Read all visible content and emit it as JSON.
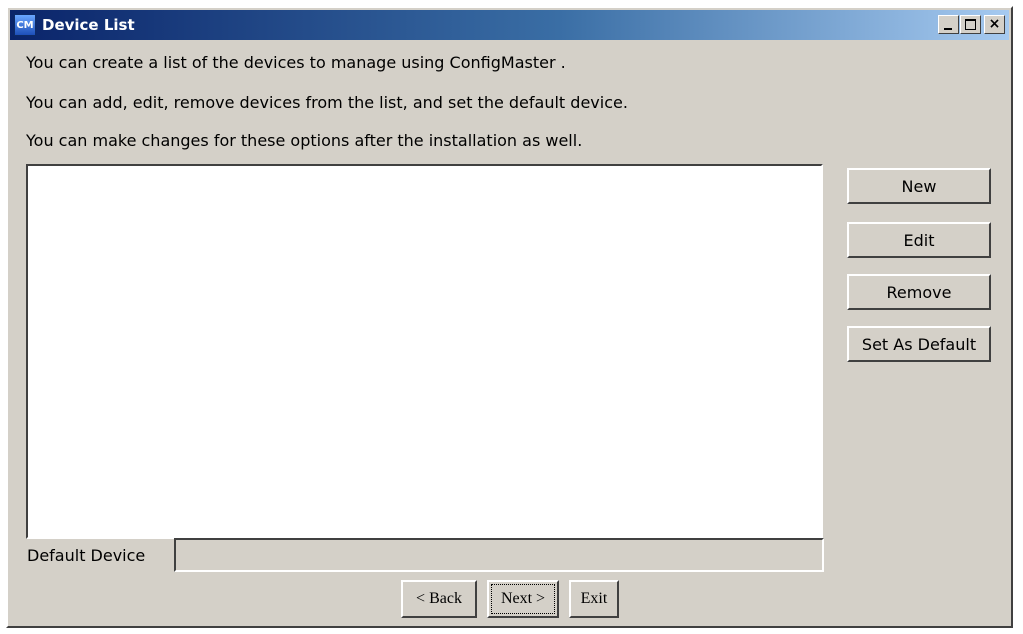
{
  "window": {
    "title": "Device List",
    "app_icon_text": "CM",
    "caption_buttons": {
      "minimize_icon": "minimize-icon",
      "maximize_icon": "maximize-icon",
      "close_icon": "close-icon",
      "close_glyph": "×"
    }
  },
  "instructions": [
    "You can create a list of the devices to manage using ConfigMaster .",
    "You can add, edit, remove devices from the list, and set the default device.",
    "You can make changes for these options after the installation as well."
  ],
  "device_list": {
    "items": []
  },
  "side_buttons": {
    "new": "New",
    "edit": "Edit",
    "remove": "Remove",
    "set_default": "Set As Default"
  },
  "default_device": {
    "label": "Default Device",
    "value": ""
  },
  "nav_buttons": {
    "back": "< Back",
    "next": "Next >",
    "exit": "Exit"
  },
  "colors": {
    "face": "#d4d0c8",
    "titlebar_start": "#0a246a",
    "titlebar_end": "#a6caf0"
  }
}
